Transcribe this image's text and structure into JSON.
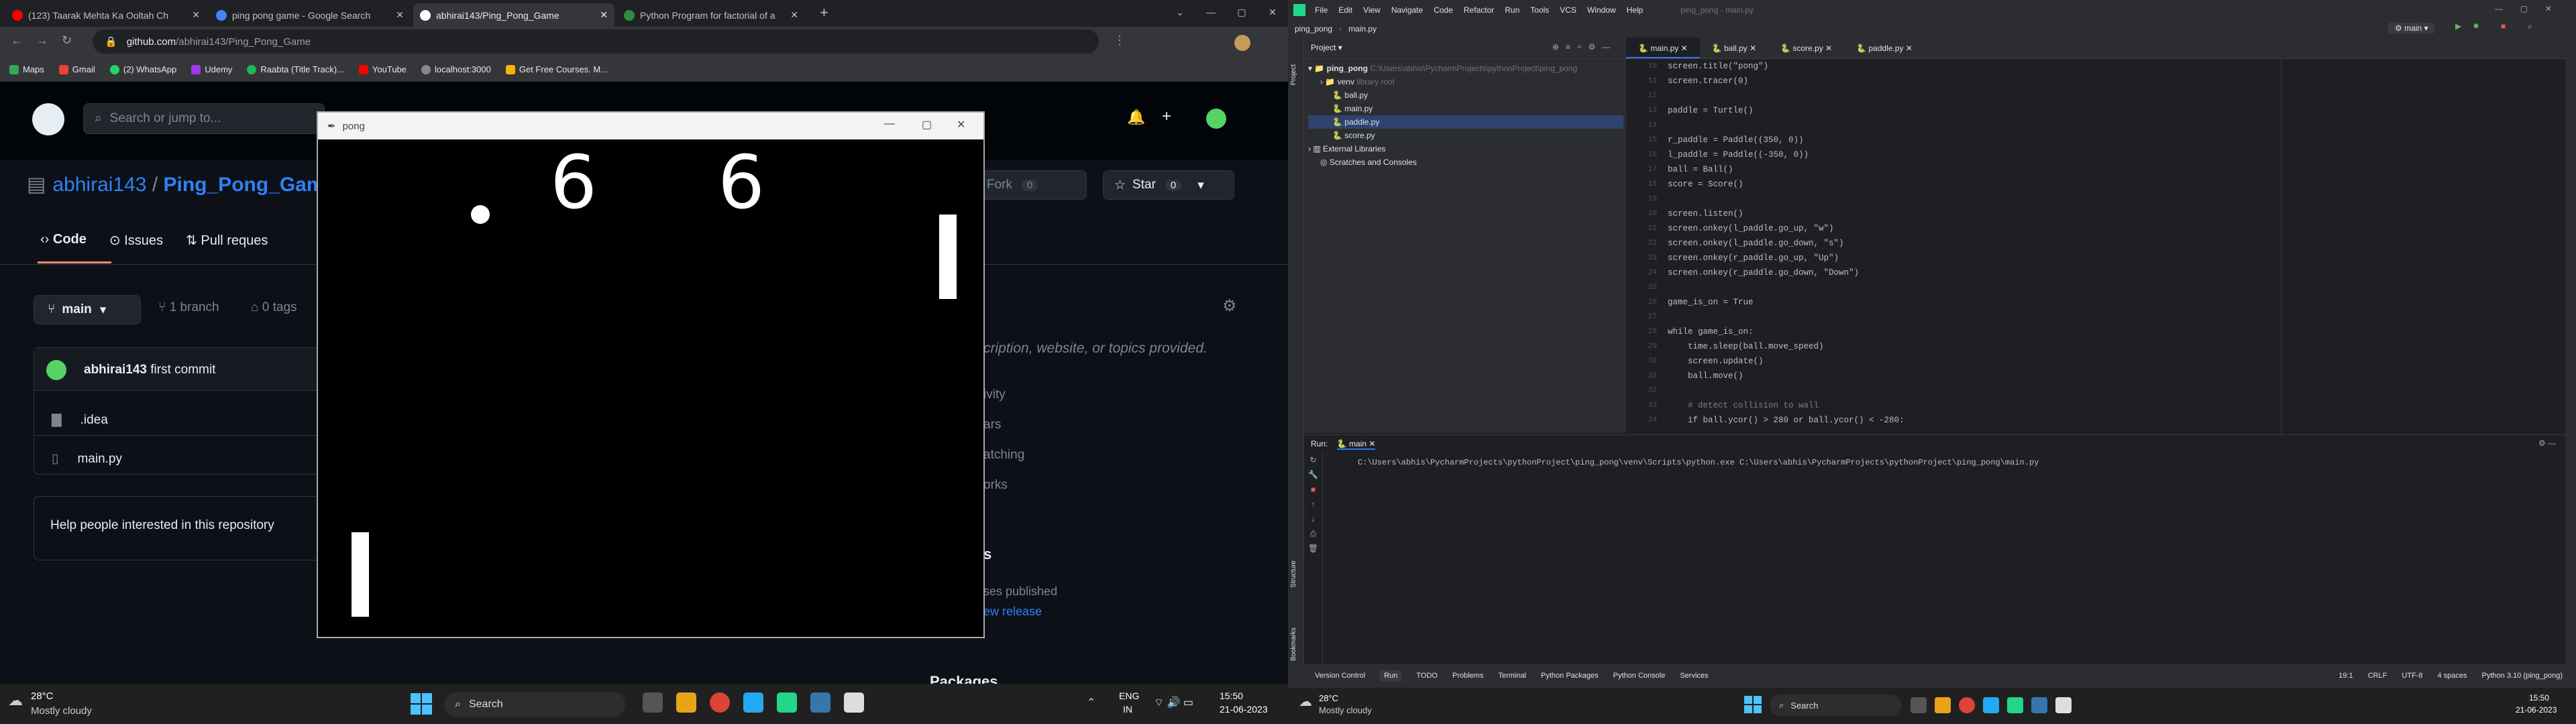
{
  "browser": {
    "tabs": [
      {
        "title": "(123) Taarak Mehta Ka Ooltah Ch",
        "color": "#ff0000"
      },
      {
        "title": "ping pong game - Google Search",
        "color": "#4285f4"
      },
      {
        "title": "abhirai143/Ping_Pong_Game",
        "color": "#ffffff",
        "active": true
      },
      {
        "title": "Python Program for factorial of a",
        "color": "#2f8d46"
      }
    ],
    "new_tab": "+",
    "url_domain": "github.com",
    "url_path": "/abhirai143/Ping_Pong_Game",
    "bookmarks": [
      "Maps",
      "Gmail",
      "(2) WhatsApp",
      "Udemy",
      "Raabta (Title Track)...",
      "YouTube",
      "localhost:3000",
      "Get Free Courses. M..."
    ]
  },
  "github": {
    "search_placeholder": "Search or jump to...",
    "owner": "abhirai143",
    "slash": " / ",
    "repo": "Ping_Pong_Game",
    "tabs": [
      "Code",
      "Issues",
      "Pull reques"
    ],
    "fork": "Fork",
    "fork_count": "0",
    "star": "Star",
    "star_count": "0",
    "branch": "main",
    "branches": "1 branch",
    "tags": "0 tags",
    "commit_author": "abhirai143",
    "commit_msg": "first commit",
    "files": [
      ".idea",
      "main.py"
    ],
    "help_text": "Help people interested in this repository",
    "about_text": "cription, website, or topics provided.",
    "about_items": [
      "ivity",
      "ars",
      "atching",
      "orks"
    ],
    "releases_heading": "s",
    "releases_text": "ses published",
    "new_release": "ew release",
    "packages": "Packages"
  },
  "pong": {
    "window_title": "pong",
    "score_left": "6",
    "score_right": "6"
  },
  "taskbar_left": {
    "weather_temp": "28°C",
    "weather_desc": "Mostly cloudy",
    "search": "Search",
    "lang1": "ENG",
    "lang2": "IN",
    "time": "15:50",
    "date": "21-06-2023"
  },
  "pycharm": {
    "menu": [
      "File",
      "Edit",
      "View",
      "Navigate",
      "Code",
      "Refactor",
      "Run",
      "Tools",
      "VCS",
      "Window",
      "Help"
    ],
    "window_title": "ping_pong - main.py",
    "breadcrumb": [
      "ping_pong",
      "main.py"
    ],
    "run_config": "main",
    "project_label": "Project",
    "tree": [
      {
        "label": "ping_pong",
        "note": "C:\\Users\\abhis\\PycharmProjects\\pythonProject\\ping_pong",
        "indent": 0
      },
      {
        "label": "venv",
        "note": "library root",
        "indent": 1
      },
      {
        "label": "ball.py",
        "note": "",
        "indent": 2
      },
      {
        "label": "main.py",
        "note": "",
        "indent": 2
      },
      {
        "label": "paddle.py",
        "note": "",
        "indent": 2,
        "selected": true
      },
      {
        "label": "score.py",
        "note": "",
        "indent": 2
      },
      {
        "label": "External Libraries",
        "note": "",
        "indent": 0
      },
      {
        "label": "Scratches and Consoles",
        "note": "",
        "indent": 0
      }
    ],
    "editor_tabs": [
      "main.py",
      "ball.py",
      "score.py",
      "paddle.py"
    ],
    "line_numbers": [
      "10",
      "11",
      "12",
      "13",
      "14",
      "15",
      "16",
      "17",
      "18",
      "19",
      "20",
      "21",
      "22",
      "23",
      "24",
      "25",
      "26",
      "27",
      "28",
      "29",
      "30",
      "31",
      "32",
      "33",
      "34"
    ],
    "code": [
      "screen.title(\"pong\")",
      "screen.tracer(0)",
      "",
      "paddle = Turtle()",
      "",
      "r_paddle = Paddle((350, 0))",
      "l_paddle = Paddle((-350, 0))",
      "ball = Ball()",
      "score = Score()",
      "",
      "screen.listen()",
      "screen.onkey(l_paddle.go_up, \"w\")",
      "screen.onkey(l_paddle.go_down, \"s\")",
      "screen.onkey(r_paddle.go_up, \"Up\")",
      "screen.onkey(r_paddle.go_down, \"Down\")",
      "",
      "game_is_on = True",
      "",
      "while game_is_on:",
      "    time.sleep(ball.move_speed)",
      "    screen.update()",
      "    ball.move()",
      "",
      "    # detect collision to wall",
      "    if ball.ycor() > 280 or ball.ycor() < -280:"
    ],
    "run_label": "Run:",
    "run_tab": "main",
    "run_command": "C:\\Users\\abhis\\PycharmProjects\\pythonProject\\ping_pong\\venv\\Scripts\\python.exe C:\\Users\\abhis\\PycharmProjects\\pythonProject\\ping_pong\\main.py",
    "bottom_tabs": [
      "Version Control",
      "Run",
      "TODO",
      "Problems",
      "Terminal",
      "Python Packages",
      "Python Console",
      "Services"
    ],
    "status": [
      "19:1",
      "CRLF",
      "UTF-8",
      "4 spaces",
      "Python 3.10 (ping_pong)"
    ],
    "side_labels": [
      "Structure",
      "Bookmarks"
    ]
  },
  "taskbar_right": {
    "weather_temp": "28°C",
    "weather_desc": "Mostly cloudy",
    "search": "Search",
    "time": "15:50",
    "date": "21-06-2023"
  }
}
